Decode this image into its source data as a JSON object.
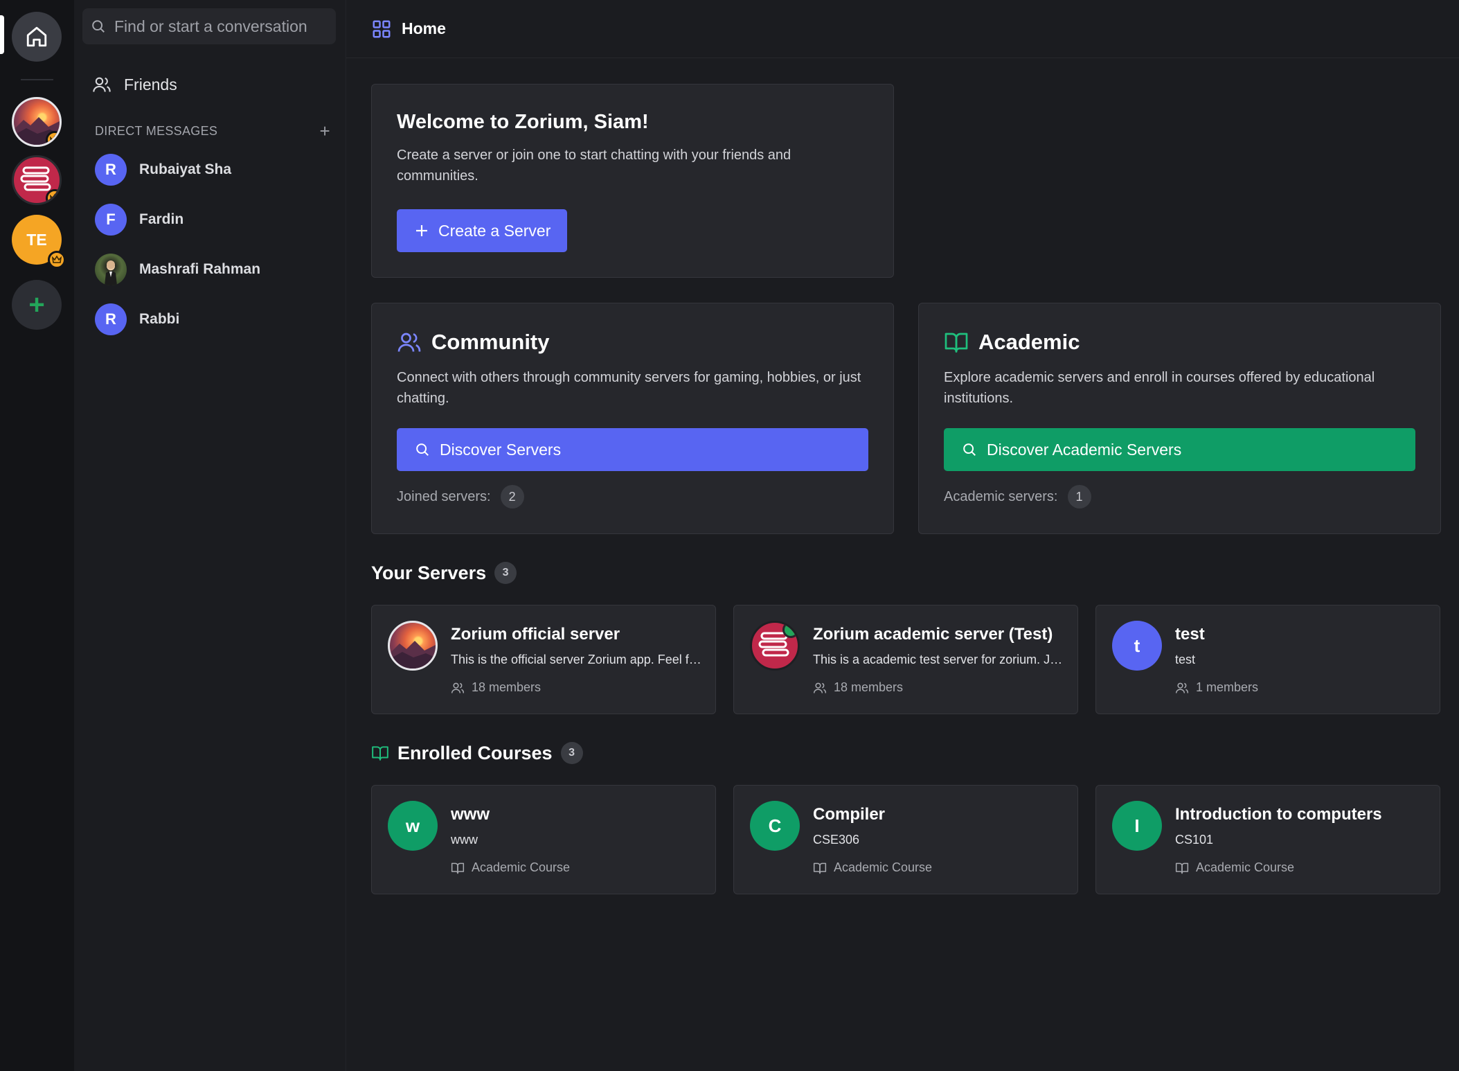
{
  "rail": {
    "servers": [
      {
        "name": "Zorium official server",
        "icon": "sunset-avatar"
      },
      {
        "name": "Zorium academic server (Test)",
        "icon": "books-avatar"
      },
      {
        "initials": "TE"
      }
    ]
  },
  "search": {
    "placeholder": "Find or start a conversation"
  },
  "sidebar": {
    "friends_label": "Friends",
    "dm_header": "DIRECT MESSAGES",
    "dms": [
      {
        "initial": "R",
        "name": "Rubaiyat Sha"
      },
      {
        "initial": "F",
        "name": "Fardin"
      },
      {
        "initial": "",
        "name": "Mashrafi Rahman"
      },
      {
        "initial": "R",
        "name": "Rabbi"
      }
    ]
  },
  "header": {
    "title": "Home"
  },
  "welcome": {
    "title": "Welcome to Zorium, Siam!",
    "description": "Create a server or join one to start chatting with your friends and communities.",
    "create_button": "Create a Server"
  },
  "community": {
    "title": "Community",
    "description": "Connect with others through community servers for gaming, hobbies, or just chatting.",
    "button": "Discover Servers",
    "stat_label": "Joined servers:",
    "stat_value": "2"
  },
  "academic": {
    "title": "Academic",
    "description": "Explore academic servers and enroll in courses offered by educational institutions.",
    "button": "Discover Academic Servers",
    "stat_label": "Academic servers:",
    "stat_value": "1"
  },
  "your_servers": {
    "title": "Your Servers",
    "count": "3",
    "items": [
      {
        "name": "Zorium official server",
        "description": "This is the official server Zorium app. Feel free to join",
        "members": "18 members"
      },
      {
        "name": "Zorium academic server (Test)",
        "description": "This is a academic test server for zorium. Join to test",
        "members": "18 members"
      },
      {
        "initial": "t",
        "name": "test",
        "description": "test",
        "members": "1 members"
      }
    ]
  },
  "enrolled_courses": {
    "title": "Enrolled Courses",
    "count": "3",
    "items": [
      {
        "initial": "w",
        "name": "www",
        "code": "www",
        "type": "Academic Course"
      },
      {
        "initial": "C",
        "name": "Compiler",
        "code": "CSE306",
        "type": "Academic Course"
      },
      {
        "initial": "I",
        "name": "Introduction to computers",
        "code": "CS101",
        "type": "Academic Course"
      }
    ]
  },
  "colors": {
    "accent_blue": "#5865f2",
    "accent_green": "#0f9d66",
    "crown_badge": "#f5a524",
    "online_green": "#23a55a"
  }
}
